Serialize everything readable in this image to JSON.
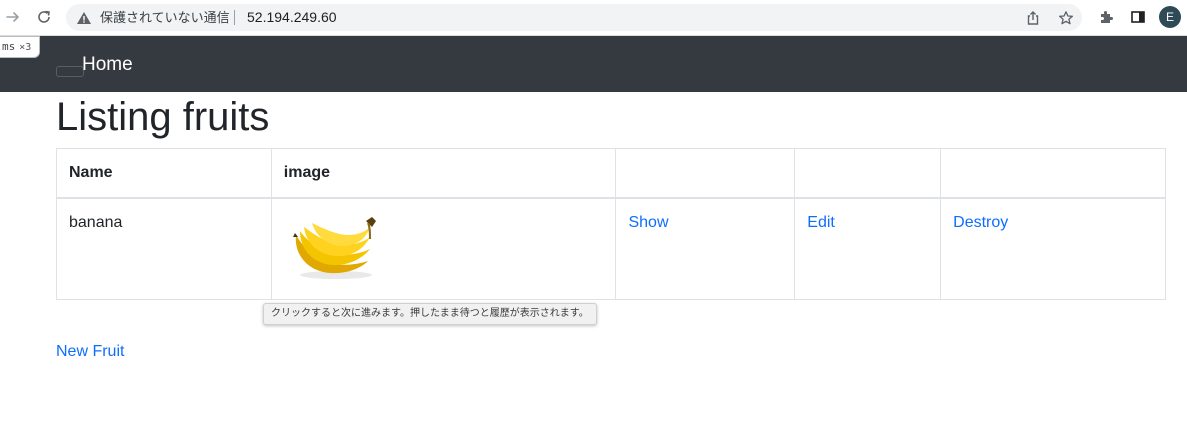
{
  "browser": {
    "security_label": "保護されていない通信",
    "url": "52.194.249.60",
    "profile_initial": "E"
  },
  "extension_tag": {
    "label": "ms",
    "count": "×3"
  },
  "navbar": {
    "brand": "Home"
  },
  "page": {
    "title": "Listing fruits"
  },
  "table": {
    "headers": [
      "Name",
      "image",
      "",
      "",
      ""
    ],
    "rows": [
      {
        "name": "banana",
        "image_alt": "banana",
        "show": "Show",
        "edit": "Edit",
        "destroy": "Destroy"
      }
    ]
  },
  "tooltip": {
    "text": "クリックすると次に進みます。押したまま待つと履歴が表示されます。"
  },
  "actions": {
    "new_fruit": "New Fruit"
  },
  "colors": {
    "navbar": "#343a40",
    "link": "#0d6efd"
  }
}
